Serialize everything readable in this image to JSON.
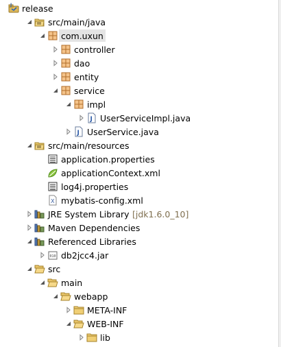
{
  "tree": [
    {
      "label": "release",
      "name": "tree-item-release",
      "icon": "java-project-icon",
      "depth": 0,
      "expanded": true
    },
    {
      "label": "src/main/java",
      "name": "tree-item-src-main-java",
      "icon": "source-folder-icon",
      "depth": 1,
      "expanded": true
    },
    {
      "label": "com.uxun",
      "name": "tree-item-com-uxun",
      "icon": "package-icon",
      "depth": 2,
      "expanded": true,
      "selected": true
    },
    {
      "label": "controller",
      "name": "tree-item-controller",
      "icon": "package-icon",
      "depth": 3,
      "expanded": false
    },
    {
      "label": "dao",
      "name": "tree-item-dao",
      "icon": "package-icon",
      "depth": 3,
      "expanded": false
    },
    {
      "label": "entity",
      "name": "tree-item-entity",
      "icon": "package-icon",
      "depth": 3,
      "expanded": false
    },
    {
      "label": "service",
      "name": "tree-item-service",
      "icon": "package-icon",
      "depth": 3,
      "expanded": true
    },
    {
      "label": "impl",
      "name": "tree-item-impl",
      "icon": "package-icon",
      "depth": 4,
      "expanded": true
    },
    {
      "label": "UserServiceImpl.java",
      "name": "tree-item-userserviceimpl-java",
      "icon": "java-file-icon",
      "depth": 5,
      "expanded": false
    },
    {
      "label": "UserService.java",
      "name": "tree-item-userservice-java",
      "icon": "java-file-icon",
      "depth": 4,
      "expanded": false
    },
    {
      "label": "src/main/resources",
      "name": "tree-item-src-main-resources",
      "icon": "source-folder-icon",
      "depth": 1,
      "expanded": true
    },
    {
      "label": "application.properties",
      "name": "tree-item-application-properties",
      "icon": "properties-file-icon",
      "depth": 2
    },
    {
      "label": "applicationContext.xml",
      "name": "tree-item-applicationcontext-xml",
      "icon": "spring-leaf-icon",
      "depth": 2
    },
    {
      "label": "log4j.properties",
      "name": "tree-item-log4j-properties",
      "icon": "properties-file-icon",
      "depth": 2
    },
    {
      "label": "mybatis-config.xml",
      "name": "tree-item-mybatis-config-xml",
      "icon": "xml-file-icon",
      "depth": 2
    },
    {
      "label": "JRE System Library",
      "decor": "[jdk1.6.0_10]",
      "name": "tree-item-jre-system-library",
      "icon": "library-icon",
      "depth": 1,
      "expanded": false
    },
    {
      "label": "Maven Dependencies",
      "name": "tree-item-maven-dependencies",
      "icon": "library-icon",
      "depth": 1,
      "expanded": false
    },
    {
      "label": "Referenced Libraries",
      "name": "tree-item-referenced-libraries",
      "icon": "library-icon",
      "depth": 1,
      "expanded": true
    },
    {
      "label": "db2jcc4.jar",
      "name": "tree-item-db2jcc4-jar",
      "icon": "jar-file-icon",
      "depth": 2,
      "expanded": false
    },
    {
      "label": "src",
      "name": "tree-item-src",
      "icon": "folder-open-icon",
      "depth": 1,
      "expanded": true
    },
    {
      "label": "main",
      "name": "tree-item-main",
      "icon": "folder-open-icon",
      "depth": 2,
      "expanded": true
    },
    {
      "label": "webapp",
      "name": "tree-item-webapp",
      "icon": "folder-open-icon",
      "depth": 3,
      "expanded": true
    },
    {
      "label": "META-INF",
      "name": "tree-item-meta-inf",
      "icon": "folder-icon",
      "depth": 4,
      "expanded": false
    },
    {
      "label": "WEB-INF",
      "name": "tree-item-web-inf",
      "icon": "folder-open-icon",
      "depth": 4,
      "expanded": true
    },
    {
      "label": "lib",
      "name": "tree-item-lib",
      "icon": "folder-icon",
      "depth": 5,
      "expanded": false
    }
  ]
}
